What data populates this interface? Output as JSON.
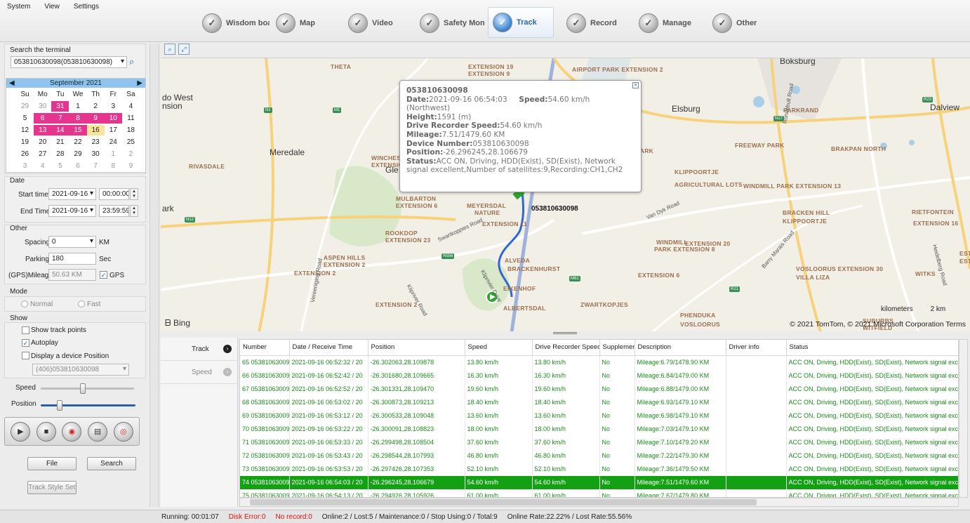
{
  "menu": [
    "System",
    "View",
    "Settings"
  ],
  "toolbar": [
    {
      "label": "Wisdom boa",
      "icon": "shield-icon"
    },
    {
      "label": "Map",
      "icon": "map-icon"
    },
    {
      "label": "Video",
      "icon": "camera-icon"
    },
    {
      "label": "Safety Mon",
      "icon": "shield-check-icon"
    },
    {
      "label": "Track",
      "icon": "track-icon",
      "active": true
    },
    {
      "label": "Record",
      "icon": "record-icon"
    },
    {
      "label": "Manage",
      "icon": "manage-icon"
    },
    {
      "label": "Other",
      "icon": "other-icon"
    }
  ],
  "search": {
    "label": "Search the terminal",
    "value": "053810630098(053810630098)"
  },
  "calendar": {
    "month": "September 2021",
    "weekdays": [
      "Su",
      "Mo",
      "Tu",
      "We",
      "Th",
      "Fr",
      "Sa"
    ],
    "days": [
      {
        "d": "29",
        "s": "o"
      },
      {
        "d": "30",
        "s": "o"
      },
      {
        "d": "31",
        "s": "t"
      },
      {
        "d": "1",
        "s": ""
      },
      {
        "d": "2",
        "s": ""
      },
      {
        "d": "3",
        "s": ""
      },
      {
        "d": "4",
        "s": ""
      },
      {
        "d": "5",
        "s": ""
      },
      {
        "d": "6",
        "s": "t"
      },
      {
        "d": "7",
        "s": "t"
      },
      {
        "d": "8",
        "s": "t"
      },
      {
        "d": "9",
        "s": "t"
      },
      {
        "d": "10",
        "s": "t"
      },
      {
        "d": "11",
        "s": ""
      },
      {
        "d": "12",
        "s": ""
      },
      {
        "d": "13",
        "s": "t"
      },
      {
        "d": "14",
        "s": "t"
      },
      {
        "d": "15",
        "s": "t"
      },
      {
        "d": "16",
        "s": "y"
      },
      {
        "d": "17",
        "s": ""
      },
      {
        "d": "18",
        "s": ""
      },
      {
        "d": "19",
        "s": ""
      },
      {
        "d": "20",
        "s": ""
      },
      {
        "d": "21",
        "s": ""
      },
      {
        "d": "22",
        "s": ""
      },
      {
        "d": "23",
        "s": ""
      },
      {
        "d": "24",
        "s": ""
      },
      {
        "d": "25",
        "s": ""
      },
      {
        "d": "26",
        "s": ""
      },
      {
        "d": "27",
        "s": ""
      },
      {
        "d": "28",
        "s": ""
      },
      {
        "d": "29",
        "s": ""
      },
      {
        "d": "30",
        "s": ""
      },
      {
        "d": "1",
        "s": "o"
      },
      {
        "d": "2",
        "s": "o"
      },
      {
        "d": "3",
        "s": "o"
      },
      {
        "d": "4",
        "s": "o"
      },
      {
        "d": "5",
        "s": "o"
      },
      {
        "d": "6",
        "s": "o"
      },
      {
        "d": "7",
        "s": "o"
      },
      {
        "d": "8",
        "s": "o"
      },
      {
        "d": "9",
        "s": "o"
      }
    ]
  },
  "date": {
    "title": "Date",
    "start_label": "Start time",
    "start_date": "2021-09-16",
    "start_time": "00:00:00",
    "end_label": "End Time",
    "end_date": "2021-09-16",
    "end_time": "23:59:59"
  },
  "other": {
    "title": "Other",
    "spacing_label": "Spacing",
    "spacing_value": "0",
    "spacing_unit": "KM",
    "parking_label": "Parking",
    "parking_value": "180",
    "parking_unit": "Sec",
    "mileage_label": "(GPS)Mileage",
    "mileage_value": "50.63 KM",
    "gps_label": "GPS"
  },
  "mode": {
    "title": "Mode",
    "normal": "Normal",
    "fast": "Fast"
  },
  "show": {
    "title": "Show",
    "track_points": "Show track points",
    "autoplay": "Autoplay",
    "device_position": "Display a device Position",
    "device_select": "(406)053810630098"
  },
  "playback": {
    "speed_label": "Speed",
    "position_label": "Position",
    "speed_level": 0.45,
    "position_level": 0.2
  },
  "buttons": {
    "file": "File",
    "search": "Search",
    "track_style": "Track Style Set"
  },
  "map": {
    "popup": {
      "id": "053810630098",
      "date_label": "Date:",
      "date": "2021-09-16 06:54:03",
      "speed_label": "Speed:",
      "speed": "54.60 km/h",
      "direction": "(Northwest)",
      "height_label": "Height:",
      "height": "1591 (m)",
      "drs_label": "Drive Recorder Speed:",
      "drs": "54.60 km/h",
      "mileage_label": "Mileage:",
      "mileage": "7.51/1479.60 KM",
      "device_label": "Device Number:",
      "device": "053810630098",
      "position_label": "Position:",
      "position": "-26.296245,28.106679",
      "status_label": "Status:",
      "status": "ACC ON, Driving, HDD(Exist), SD(Exist), Network signal excellent,Number of satellites:9,Recording:CH1,CH2"
    },
    "vehicle_label": "053810630098",
    "attribution": "© 2021 TomTom, © 2021 Microsoft Corporation Terms",
    "bing": "Bing",
    "scale_unit": "kilometers",
    "scale_value": "2 km",
    "places": [
      "THETA",
      "EXTENSION 19",
      "EXTENSION 9",
      "AIRPORT PARK EXTENSION 2",
      "Boksburg",
      "do West",
      "nsion",
      "Elsburg",
      "PARKRAND",
      "Dalview",
      "FREEWAY PARK",
      "BRAKPAN NORTH",
      "Meredale",
      "WINCHESTER HILLS",
      "EXTENSION 1",
      "RIVASDALE",
      "Gle",
      "ELSPARK",
      "KLIPPOORTJE",
      "AGRICULTURAL LOTS",
      "WINDMILL PARK EXTENSION 13",
      "ark",
      "MULBARTON",
      "EXTENSION 6",
      "MEYERSDAL",
      "NATURE",
      "EXTENSION 11",
      "BRACKEN HILL",
      "KLIPPOORTJE",
      "EXTENSION 20",
      "WINDMILL",
      "PARK EXTENSION 8",
      "ROOKDOP",
      "EXTENSION 23",
      "ASPEN HILLS",
      "EXTENSION 2",
      "ALVEDA",
      "BRACKENHURST",
      "EXTENSION 2",
      "EIKENHOF",
      "ALBERTSDAL",
      "EXTENSION 6",
      "VOSLOORUS EXTENSION 30",
      "VILLA LIZA",
      "EXTENSION 2",
      "ZWARTKOPJES",
      "PHENDUKA",
      "VOSLOORUS",
      "SUBURBS",
      "WITFIELD",
      "RIETFONTEIN",
      "EXTENSION 16",
      "WITKS",
      "ESTATES",
      "ESTATE"
    ],
    "roads": [
      "Rondebult Road",
      "N17",
      "N1",
      "M1",
      "R554",
      "N12",
      "Swartkoppies Road",
      "Van Dyk Road",
      "Kliprivier Drive",
      "Barry Marais Road",
      "Heidelberg Road",
      "Vereeniging Road",
      "Klipriver Road",
      "R23",
      "R556",
      "M61",
      "R21"
    ]
  },
  "tabs": [
    "Track",
    "Speed"
  ],
  "table": {
    "columns": [
      "Number",
      "Date / Receive Time",
      "Position",
      "Speed",
      "Drive Recorder Speed",
      "Supplement",
      "Description",
      "Driver info",
      "Status"
    ],
    "rows": [
      [
        "65 053810630098",
        "2021-09-16 06:52:32 / 20",
        "-26.302063,28.109878",
        "13.80 km/h",
        "13.80 km/h",
        "No",
        "Mileage:6.79/1478.90 KM",
        "",
        "ACC ON, Driving, HDD(Exist), SD(Exist), Network signal exc"
      ],
      [
        "66 053810630098",
        "2021-09-16 06:52:42 / 20",
        "-26.301680,28.109665",
        "16.30 km/h",
        "16.30 km/h",
        "No",
        "Mileage:6.84/1479.00 KM",
        "",
        "ACC ON, Driving, HDD(Exist), SD(Exist), Network signal exc"
      ],
      [
        "67 053810630098",
        "2021-09-16 06:52:52 / 20",
        "-26.301331,28.109470",
        "19.60 km/h",
        "19.60 km/h",
        "No",
        "Mileage:6.88/1479.00 KM",
        "",
        "ACC ON, Driving, HDD(Exist), SD(Exist), Network signal exc"
      ],
      [
        "68 053810630098",
        "2021-09-16 06:53:02 / 20",
        "-26.300873,28.109213",
        "18.40 km/h",
        "18.40 km/h",
        "No",
        "Mileage:6.93/1479.10 KM",
        "",
        "ACC ON, Driving, HDD(Exist), SD(Exist), Network signal exc"
      ],
      [
        "69 053810630098",
        "2021-09-16 06:53:12 / 20",
        "-26.300533,28.109048",
        "13.60 km/h",
        "13.60 km/h",
        "No",
        "Mileage:6.98/1479.10 KM",
        "",
        "ACC ON, Driving, HDD(Exist), SD(Exist), Network signal exc"
      ],
      [
        "70 053810630098",
        "2021-09-16 06:53:22 / 20",
        "-26.300091,28.108823",
        "18.00 km/h",
        "18.00 km/h",
        "No",
        "Mileage:7.03/1479.10 KM",
        "",
        "ACC ON, Driving, HDD(Exist), SD(Exist), Network signal exc"
      ],
      [
        "71 053810630098",
        "2021-09-16 06:53:33 / 20",
        "-26.299498,28.108504",
        "37.60 km/h",
        "37.60 km/h",
        "No",
        "Mileage:7.10/1479.20 KM",
        "",
        "ACC ON, Driving, HDD(Exist), SD(Exist), Network signal exc"
      ],
      [
        "72 053810630098",
        "2021-09-16 06:53:43 / 20",
        "-26.298544,28.107993",
        "46.80 km/h",
        "46.80 km/h",
        "No",
        "Mileage:7.22/1479.30 KM",
        "",
        "ACC ON, Driving, HDD(Exist), SD(Exist), Network signal exc"
      ],
      [
        "73 053810630098",
        "2021-09-16 06:53:53 / 20",
        "-26.297426,28.107353",
        "52.10 km/h",
        "52.10 km/h",
        "No",
        "Mileage:7.36/1479.50 KM",
        "",
        "ACC ON, Driving, HDD(Exist), SD(Exist), Network signal exc"
      ],
      [
        "74 053810630098",
        "2021-09-16 06:54:03 / 20",
        "-26.296245,28.106679",
        "54.60 km/h",
        "54.60 km/h",
        "No",
        "Mileage:7.51/1479.60 KM",
        "",
        "ACC ON, Driving, HDD(Exist), SD(Exist), Network signal exc"
      ],
      [
        "75 053810630098",
        "2021-09-16 06:54:13 / 20",
        "-26.294926,28.105926",
        "61.00 km/h",
        "61.00 km/h",
        "No",
        "Mileage:7.67/1479.80 KM",
        "",
        "ACC ON, Driving, HDD(Exist), SD(Exist), Network signal exc"
      ]
    ],
    "selected_index": 9
  },
  "status": {
    "running": "Running: 00:01:07",
    "disk_error": "Disk Error:0",
    "no_record": "No record:0",
    "counts": "Online:2 / Lost:5 / Maintenance:0 / Stop Using:0 / Total:9",
    "rates": "Online Rate:22.22% / Lost Rate:55.56%"
  },
  "colors": {
    "accent": "#2a62b8",
    "calendar_highlight": "#e6358f",
    "calendar_today": "#fae39b",
    "row_text": "#1c8a1c",
    "row_selected": "#13a113",
    "route": "#2f66d6"
  }
}
